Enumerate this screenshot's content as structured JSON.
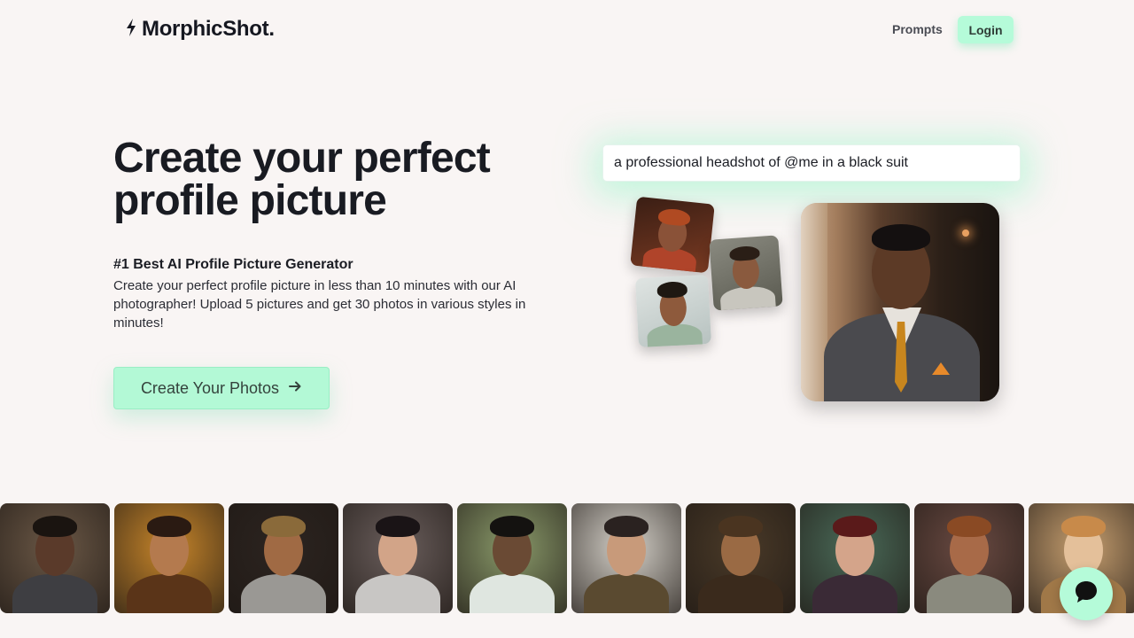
{
  "nav": {
    "logo_text": "MorphicShot.",
    "prompts_label": "Prompts",
    "login_label": "Login"
  },
  "hero": {
    "title_line1": "Create your perfect",
    "title_line2": "profile picture",
    "subtitle": "#1 Best AI Profile Picture Generator",
    "description": "Create your perfect profile picture in less than 10 minutes with our AI photographer! Upload 5 pictures and get 30 photos in various styles in minutes!",
    "cta_label": "Create Your Photos"
  },
  "demo": {
    "prompt_text": "a professional headshot of @me in a black suit"
  },
  "gallery": {
    "tiles": [
      {
        "name": "gallery-photo-suit-man",
        "bg": "#6b5846",
        "skin": "#5a3a2a",
        "hair": "#1a1410",
        "cloth": "#3e3e42"
      },
      {
        "name": "gallery-photo-warrior-woman",
        "bg": "#c8862a",
        "skin": "#b47a4e",
        "hair": "#2a1a12",
        "cloth": "#5a3418"
      },
      {
        "name": "gallery-photo-armored-man",
        "bg": "#2c2420",
        "skin": "#a06a44",
        "hair": "#8a6a3a",
        "cloth": "#9a9894"
      },
      {
        "name": "gallery-photo-silver-woman",
        "bg": "#6a5e5c",
        "skin": "#d2a488",
        "hair": "#1a1416",
        "cloth": "#c8c6c4"
      },
      {
        "name": "gallery-photo-space-man",
        "bg": "#8a9a6a",
        "skin": "#6a4a34",
        "hair": "#141210",
        "cloth": "#dfe6e0"
      },
      {
        "name": "gallery-photo-asian-woman",
        "bg": "#d6d2ca",
        "skin": "#c89a7a",
        "hair": "#2a2220",
        "cloth": "#5a4a30"
      },
      {
        "name": "gallery-photo-rugged-man",
        "bg": "#4a3a28",
        "skin": "#9a6a44",
        "hair": "#4a3420",
        "cloth": "#3a2a1c"
      },
      {
        "name": "gallery-photo-painted-woman",
        "bg": "#4a6a58",
        "skin": "#d4a48a",
        "hair": "#5a1a1a",
        "cloth": "#3a2a36"
      },
      {
        "name": "gallery-photo-glasses-man",
        "bg": "#6a4a42",
        "skin": "#a86a48",
        "hair": "#8a4a24",
        "cloth": "#8a8a7e"
      },
      {
        "name": "gallery-photo-elf-woman",
        "bg": "#c8a070",
        "skin": "#e4c09a",
        "hair": "#c88a4a",
        "cloth": "#a07848"
      }
    ]
  },
  "colors": {
    "accent": "#b5fbd9",
    "background": "#f9f5f4",
    "text": "#191b22"
  },
  "icons": {
    "logo": "lightning-bolt-icon",
    "cta": "arrow-right-icon",
    "chat": "chat-bubble-icon"
  }
}
